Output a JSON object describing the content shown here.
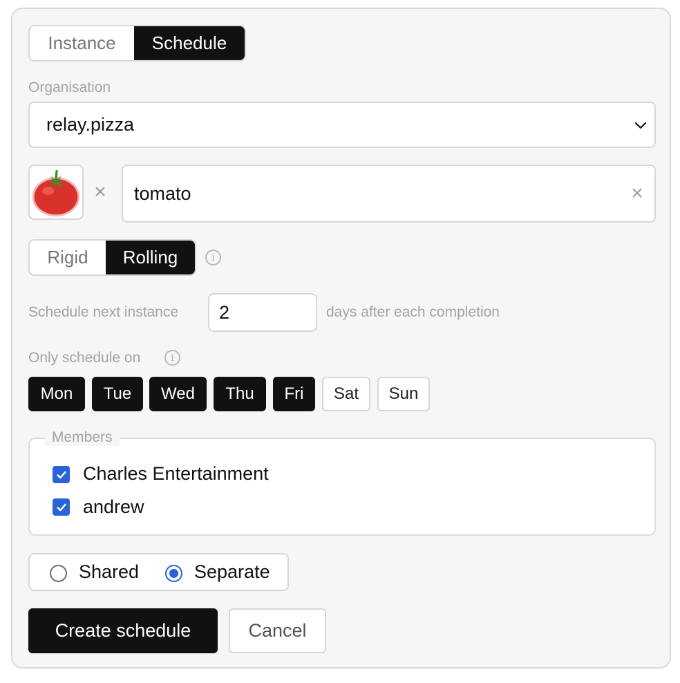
{
  "mode_tabs": [
    {
      "label": "Instance",
      "active": false
    },
    {
      "label": "Schedule",
      "active": true
    }
  ],
  "organisation": {
    "label": "Organisation",
    "value": "relay.pizza"
  },
  "icon": {
    "name": "tomato-emoji-icon"
  },
  "name_input": {
    "value": "tomato"
  },
  "schedule_type": [
    {
      "label": "Rigid",
      "active": false
    },
    {
      "label": "Rolling",
      "active": true
    }
  ],
  "interval": {
    "prefix": "Schedule next instance",
    "value": "2",
    "suffix": "days after each completion"
  },
  "days": {
    "label": "Only schedule on",
    "items": [
      {
        "label": "Mon",
        "selected": true
      },
      {
        "label": "Tue",
        "selected": true
      },
      {
        "label": "Wed",
        "selected": true
      },
      {
        "label": "Thu",
        "selected": true
      },
      {
        "label": "Fri",
        "selected": true
      },
      {
        "label": "Sat",
        "selected": false
      },
      {
        "label": "Sun",
        "selected": false
      }
    ]
  },
  "members": {
    "legend": "Members",
    "items": [
      {
        "name": "Charles Entertainment",
        "checked": true
      },
      {
        "name": "andrew",
        "checked": true
      }
    ]
  },
  "assignment": {
    "options": [
      {
        "label": "Shared",
        "selected": false
      },
      {
        "label": "Separate",
        "selected": true
      }
    ]
  },
  "actions": {
    "create": "Create schedule",
    "cancel": "Cancel"
  },
  "colors": {
    "accent": "#2a63d6",
    "dark": "#111111"
  }
}
